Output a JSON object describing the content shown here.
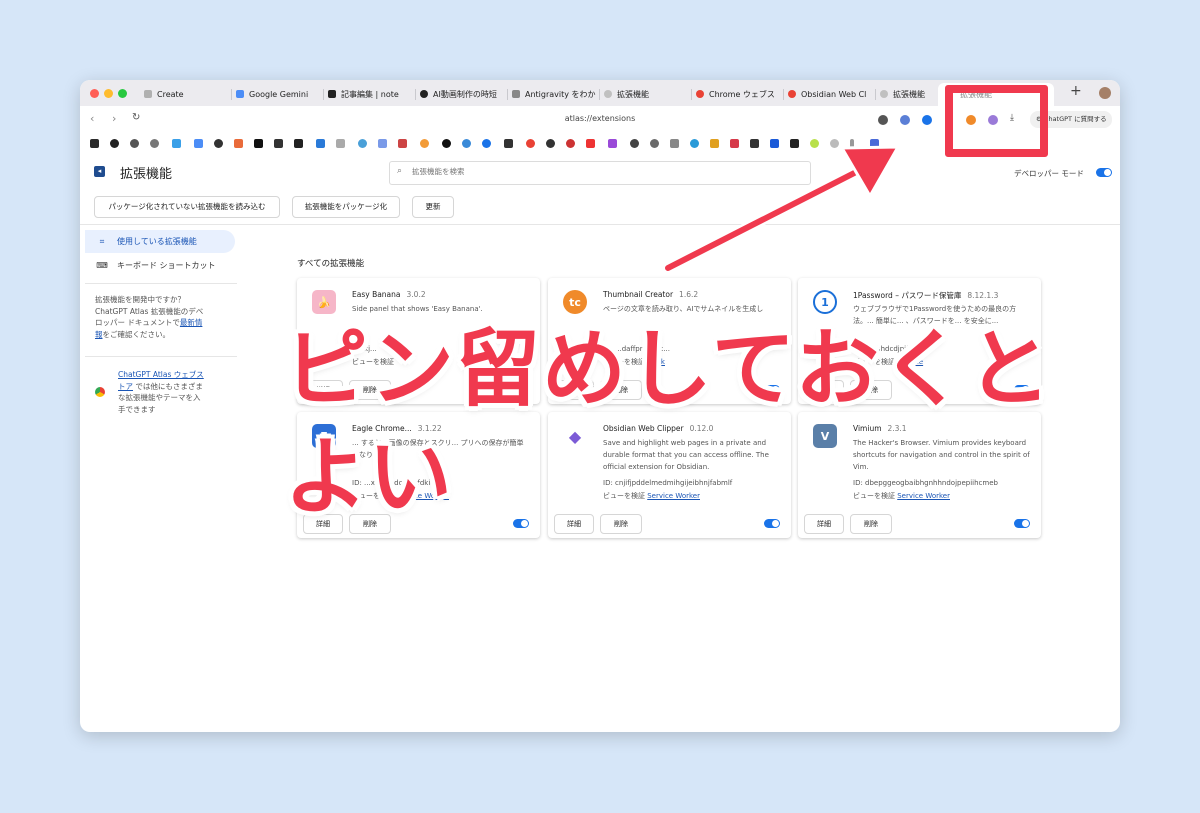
{
  "browser": {
    "tabs": [
      {
        "label": "Create",
        "color": "#9aa0a6"
      },
      {
        "label": "Google Gemini",
        "color": "#4c8df6"
      },
      {
        "label": "記事編集 | note",
        "color": "#222222"
      },
      {
        "label": "AI動画制作の時短",
        "color": "#222222"
      },
      {
        "label": "Antigravity をわか",
        "color": "#666666"
      },
      {
        "label": "拡張機能",
        "color": "#c0c0c0"
      },
      {
        "label": "Chrome ウェブス",
        "color": "#e94235"
      },
      {
        "label": "Obsidian Web Cl",
        "color": "#e94235"
      },
      {
        "label": "拡張機能",
        "color": "#c0c0c0"
      },
      {
        "label": "拡張機能",
        "color": "#c0c0c0"
      }
    ],
    "new_tab": "+",
    "url": "atlas://extensions",
    "ask_button": "ChatGPT に質問する"
  },
  "header": {
    "title": "拡張機能",
    "search_placeholder": "拡張機能を検索",
    "dev_mode_label": "デベロッパー モード",
    "buttons": [
      "パッケージ化されていない拡張機能を読み込む",
      "拡張機能をパッケージ化",
      "更新"
    ]
  },
  "sidebar": {
    "items": [
      {
        "label": "使用している拡張機能",
        "icon": "puzzle-icon"
      },
      {
        "label": "キーボード ショートカット",
        "icon": "keyboard-icon"
      }
    ],
    "dev_text_1": "拡張機能を開発中ですか？",
    "dev_text_2": "ChatGPT Atlas 拡張機能のデベ",
    "dev_text_3": "ロッパー ドキュメントで",
    "dev_link_1": "最新情",
    "dev_link_2": "報",
    "dev_text_4": "をご確認ください。",
    "store_link_1": "ChatGPT Atlas ウェブス",
    "store_link_2": "トア",
    "store_text_1": " では他にもさまざま",
    "store_text_2": "な拡張機能やテーマを入",
    "store_text_3": "手できます"
  },
  "main": {
    "section_title": "すべての拡張機能",
    "details_label": "詳細",
    "remove_label": "削除",
    "cards": [
      {
        "name": "Easy Banana",
        "version": "3.0.2",
        "desc": "Side panel that shows 'Easy Banana'.",
        "id": "ID: kj...",
        "inspect": "ビューを検証",
        "link": "",
        "icon_color": "#f6b6c8",
        "icon_text": "🍌"
      },
      {
        "name": "Thumbnail Creator",
        "version": "1.6.2",
        "desc": "ページの文章を読み取り、AIでサムネイルを生成し",
        "id": "ID: ...daffpr...lhpc...",
        "inspect": "ビューを検証",
        "link": "Work",
        "icon_color": "#f08a2a",
        "icon_text": "tc"
      },
      {
        "name": "1Password – パスワード保管庫",
        "version": "8.12.1.3",
        "desc": "ウェブブラウザで1Passwordを使うための最良の方法。... 簡単に... 、パスワードを... を安全に...",
        "id": "ID: ...nhhdcdjpifhh...",
        "inspect": "ビューを検証",
        "link": "Service",
        "icon_color": "#1a6fd8",
        "icon_text": "1"
      },
      {
        "name": "Eagle Chrome...",
        "version": "3.1.22",
        "desc": "... すると、画像の保存とスクリ... プリへの保存が簡単になり...",
        "id": "ID: ...xhc...edcigeafdkid",
        "inspect": "ビューを検証",
        "link": "Service Worker",
        "icon_color": "#2d6fd6",
        "icon_text": "E"
      },
      {
        "name": "Obsidian Web Clipper",
        "version": "0.12.0",
        "desc": "Save and highlight web pages in a private and durable format that you can access offline. The official extension for Obsidian.",
        "id": "ID: cnjifjpddelmedmihgijeibhnjfabmlf",
        "inspect": "ビューを検証",
        "link": "Service Worker",
        "icon_color": "#7c5bd6",
        "icon_text": "◆"
      },
      {
        "name": "Vimium",
        "version": "2.3.1",
        "desc": "The Hacker's Browser. Vimium provides keyboard shortcuts for navigation and control in the spirit of Vim.",
        "id": "ID: dbepggeogbaibhgnhhndojpepiihcmeb",
        "inspect": "ビューを検証",
        "link": "Service Worker",
        "icon_color": "#5a7fa8",
        "icon_text": "V"
      }
    ]
  },
  "annotation": {
    "line1": "ピン留めしておくと",
    "line2": "よい",
    "color": "#f0394e"
  }
}
